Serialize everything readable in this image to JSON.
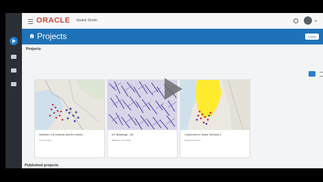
{
  "header": {
    "brand": "ORACLE",
    "product": "Spatial Studio"
  },
  "page": {
    "title": "Projects",
    "create_label": "Create"
  },
  "sections": {
    "projects_title": "Projects",
    "published_title": "Published projects"
  },
  "projects": [
    {
      "title": "Northern CA Schools and fire zones",
      "desc": "A new project"
    },
    {
      "title": "NY Buildings - 3D",
      "desc": "Buildings in NY State"
    },
    {
      "title": "Customers in Sales Territory 3",
      "desc": "Shopping centers"
    }
  ],
  "icons": {
    "menu": "hamburger-icon",
    "settings": "gear-icon",
    "home": "home-icon",
    "grid": "grid-view-icon",
    "list": "list-view-icon",
    "play": "play-icon"
  },
  "colors": {
    "brand_red": "#c74634",
    "title_bar": "#1f72b8",
    "rail": "#2b2f35"
  }
}
